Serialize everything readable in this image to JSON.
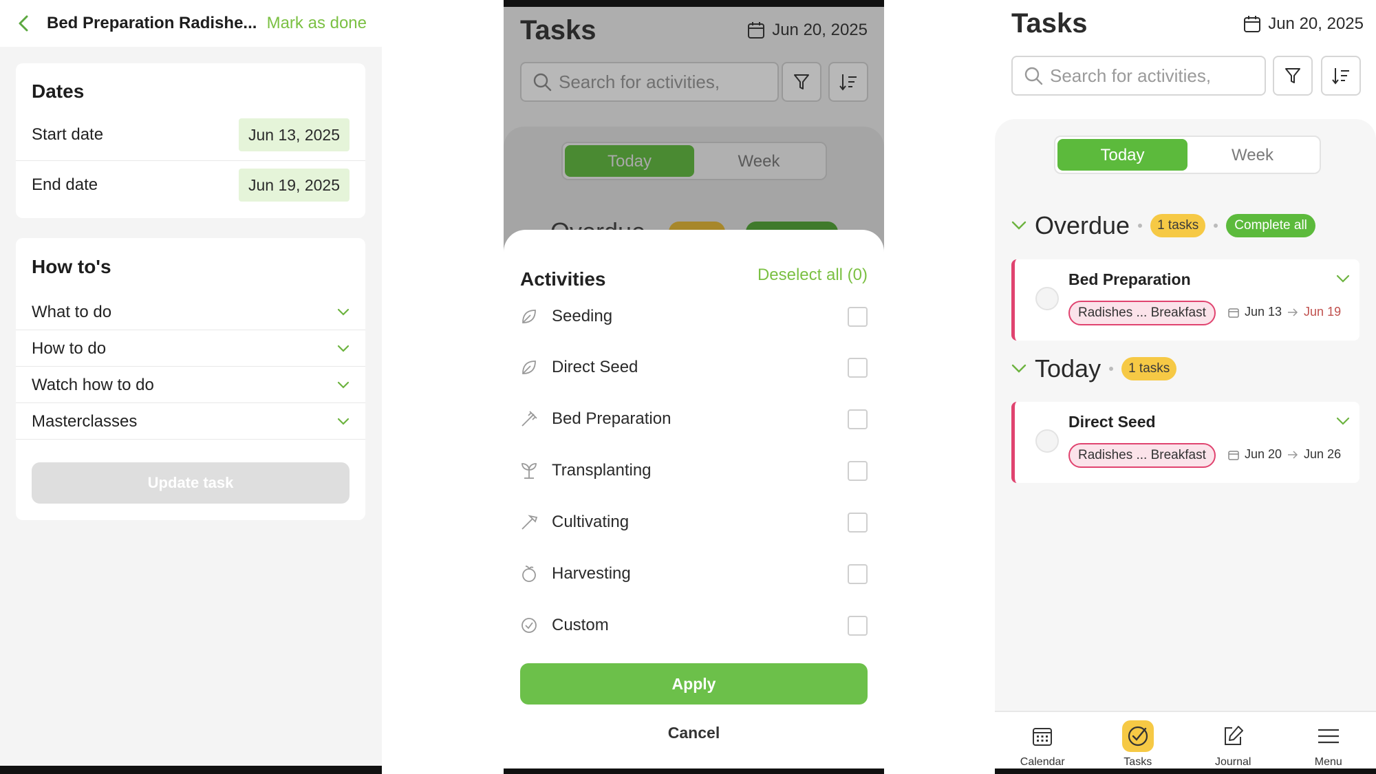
{
  "screen1": {
    "header": {
      "title": "Bed Preparation Radishe...",
      "mark_done": "Mark as done"
    },
    "dates": {
      "title": "Dates",
      "start_label": "Start date",
      "start_value": "Jun 13, 2025",
      "end_label": "End date",
      "end_value": "Jun 19, 2025"
    },
    "howto": {
      "title": "How to's",
      "items": [
        {
          "label": "What to do"
        },
        {
          "label": "How to do"
        },
        {
          "label": "Watch how to do"
        },
        {
          "label": "Masterclasses"
        }
      ],
      "update_button": "Update task"
    }
  },
  "screen2": {
    "title": "Tasks",
    "date": "Jun 20, 2025",
    "search_placeholder": "Search for activities,",
    "tabs": {
      "today": "Today",
      "week": "Week"
    },
    "peek_title": "Overdue",
    "sheet": {
      "title": "Activities",
      "deselect": "Deselect all (0)",
      "activities": [
        {
          "label": "Seeding",
          "icon": "leaf-icon"
        },
        {
          "label": "Direct Seed",
          "icon": "leaf-icon"
        },
        {
          "label": "Bed Preparation",
          "icon": "rake-icon"
        },
        {
          "label": "Transplanting",
          "icon": "sprout-icon"
        },
        {
          "label": "Cultivating",
          "icon": "hoe-icon"
        },
        {
          "label": "Harvesting",
          "icon": "basket-icon"
        },
        {
          "label": "Custom",
          "icon": "check-circle-icon"
        }
      ],
      "apply": "Apply",
      "cancel": "Cancel"
    }
  },
  "screen3": {
    "title": "Tasks",
    "date": "Jun 20, 2025",
    "search_placeholder": "Search for activities,",
    "tabs": {
      "today": "Today",
      "week": "Week"
    },
    "overdue": {
      "title": "Overdue",
      "count": "1 tasks",
      "complete_all": "Complete all",
      "task": {
        "name": "Bed Preparation",
        "tag": "Radishes ... Breakfast",
        "start": "Jun 13",
        "end": "Jun 19"
      }
    },
    "today": {
      "title": "Today",
      "count": "1 tasks",
      "task": {
        "name": "Direct Seed",
        "tag": "Radishes ... Breakfast",
        "start": "Jun 20",
        "end": "Jun 26"
      }
    },
    "nav": [
      {
        "label": "Calendar",
        "icon": "calendar-icon"
      },
      {
        "label": "Tasks",
        "icon": "tasks-check-icon"
      },
      {
        "label": "Journal",
        "icon": "journal-edit-icon"
      },
      {
        "label": "Menu",
        "icon": "menu-icon"
      }
    ]
  },
  "colors": {
    "accent_green": "#5cba3c",
    "light_green": "#e5f4d9",
    "badge_yellow": "#f6c945",
    "overdue_pink": "#e0436f"
  }
}
